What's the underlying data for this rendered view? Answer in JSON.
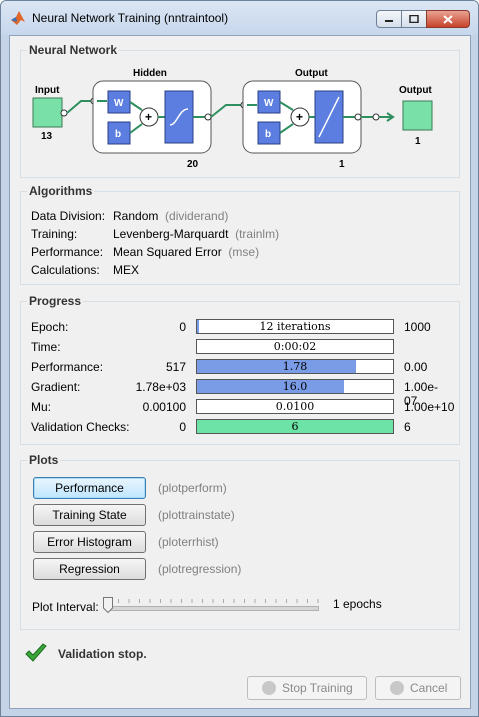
{
  "window": {
    "title": "Neural Network Training (nntraintool)"
  },
  "network": {
    "section_title": "Neural Network",
    "input_label": "Input",
    "input_size": "13",
    "hidden_label": "Hidden",
    "hidden_size": "20",
    "output_layer_label": "Output",
    "output_layer_size": "1",
    "output_label": "Output",
    "output_size": "1",
    "weight_symbol": "W",
    "bias_symbol": "b",
    "sum_symbol": "+"
  },
  "algorithms": {
    "section_title": "Algorithms",
    "rows": [
      {
        "key": "Data Division:",
        "value": "Random",
        "fn": "(dividerand)"
      },
      {
        "key": "Training:",
        "value": "Levenberg-Marquardt",
        "fn": "(trainlm)"
      },
      {
        "key": "Performance:",
        "value": "Mean Squared Error",
        "fn": "(mse)"
      },
      {
        "key": "Calculations:",
        "value": "MEX",
        "fn": ""
      }
    ]
  },
  "progress": {
    "section_title": "Progress",
    "rows": [
      {
        "label": "Epoch:",
        "start": "0",
        "text": "12 iterations",
        "end": "1000",
        "fill_fraction": 0.012,
        "color": "#7a9be6"
      },
      {
        "label": "Time:",
        "start": "",
        "text": "0:00:02",
        "end": "",
        "fill_fraction": 0,
        "color": "#7a9be6"
      },
      {
        "label": "Performance:",
        "start": "517",
        "text": "1.78",
        "end": "0.00",
        "fill_fraction": 0.81,
        "color": "#7a9be6"
      },
      {
        "label": "Gradient:",
        "start": "1.78e+03",
        "text": "16.0",
        "end": "1.00e-07",
        "fill_fraction": 0.75,
        "color": "#7a9be6"
      },
      {
        "label": "Mu:",
        "start": "0.00100",
        "text": "0.0100",
        "end": "1.00e+10",
        "fill_fraction": 0,
        "color": "#7a9be6"
      },
      {
        "label": "Validation Checks:",
        "start": "0",
        "text": "6",
        "end": "6",
        "fill_fraction": 1.0,
        "color": "#6ee3a8"
      }
    ]
  },
  "plots": {
    "section_title": "Plots",
    "buttons": [
      {
        "label": "Performance",
        "fn": "(plotperform)"
      },
      {
        "label": "Training State",
        "fn": "(plottrainstate)"
      },
      {
        "label": "Error Histogram",
        "fn": "(ploterrhist)"
      },
      {
        "label": "Regression",
        "fn": "(plotregression)"
      }
    ],
    "interval_label": "Plot Interval:",
    "interval_value": "1 epochs",
    "interval_fraction": 0
  },
  "status": {
    "text": "Validation stop.",
    "icon": "checkmark-icon",
    "color": "#3aa63a"
  },
  "footer": {
    "stop_label": "Stop Training",
    "cancel_label": "Cancel"
  },
  "colors": {
    "blue_block": "#5b7ee0",
    "green_block": "#79e0a8",
    "accent": "#3c7fb1"
  }
}
